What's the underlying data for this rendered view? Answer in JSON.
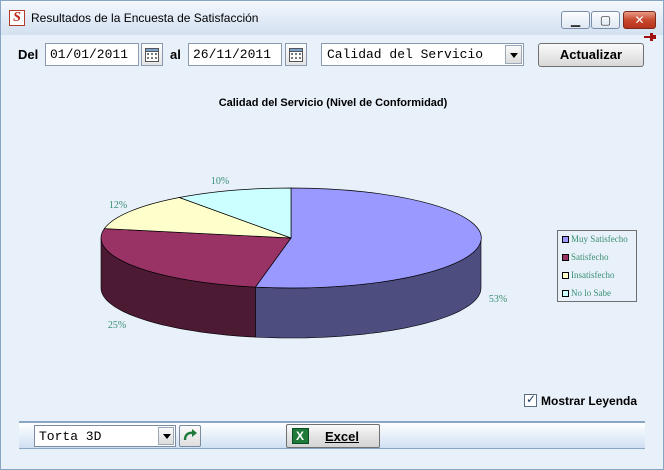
{
  "window": {
    "title": "Resultados de la Encuesta de Satisfacción"
  },
  "filters": {
    "from_label": "Del",
    "from_date": "01/01/2011",
    "to_label": "al",
    "to_date": "26/11/2011",
    "category": "Calidad del Servicio",
    "update_label": "Actualizar"
  },
  "chart_data": {
    "type": "pie",
    "title": "Calidad del Servicio (Nivel de Conformidad)",
    "three_d": true,
    "categories": [
      "Muy Satisfecho",
      "Satisfecho",
      "Insatisfecho",
      "No lo Sabe"
    ],
    "values": [
      53,
      25,
      12,
      10
    ],
    "labels": [
      "53%",
      "25%",
      "12%",
      "10%"
    ],
    "colors": [
      "#9999ff",
      "#993366",
      "#ffffcc",
      "#ccffff"
    ],
    "legend": "right"
  },
  "legend_toggle": {
    "label": "Mostrar Leyenda",
    "checked": true
  },
  "bottom": {
    "chart_type": "Torta 3D",
    "excel_label": "Excel"
  },
  "icons": {
    "app": "s-logo-icon",
    "calendar": "calendar-icon",
    "refresh": "refresh-icon",
    "excel": "excel-icon"
  }
}
